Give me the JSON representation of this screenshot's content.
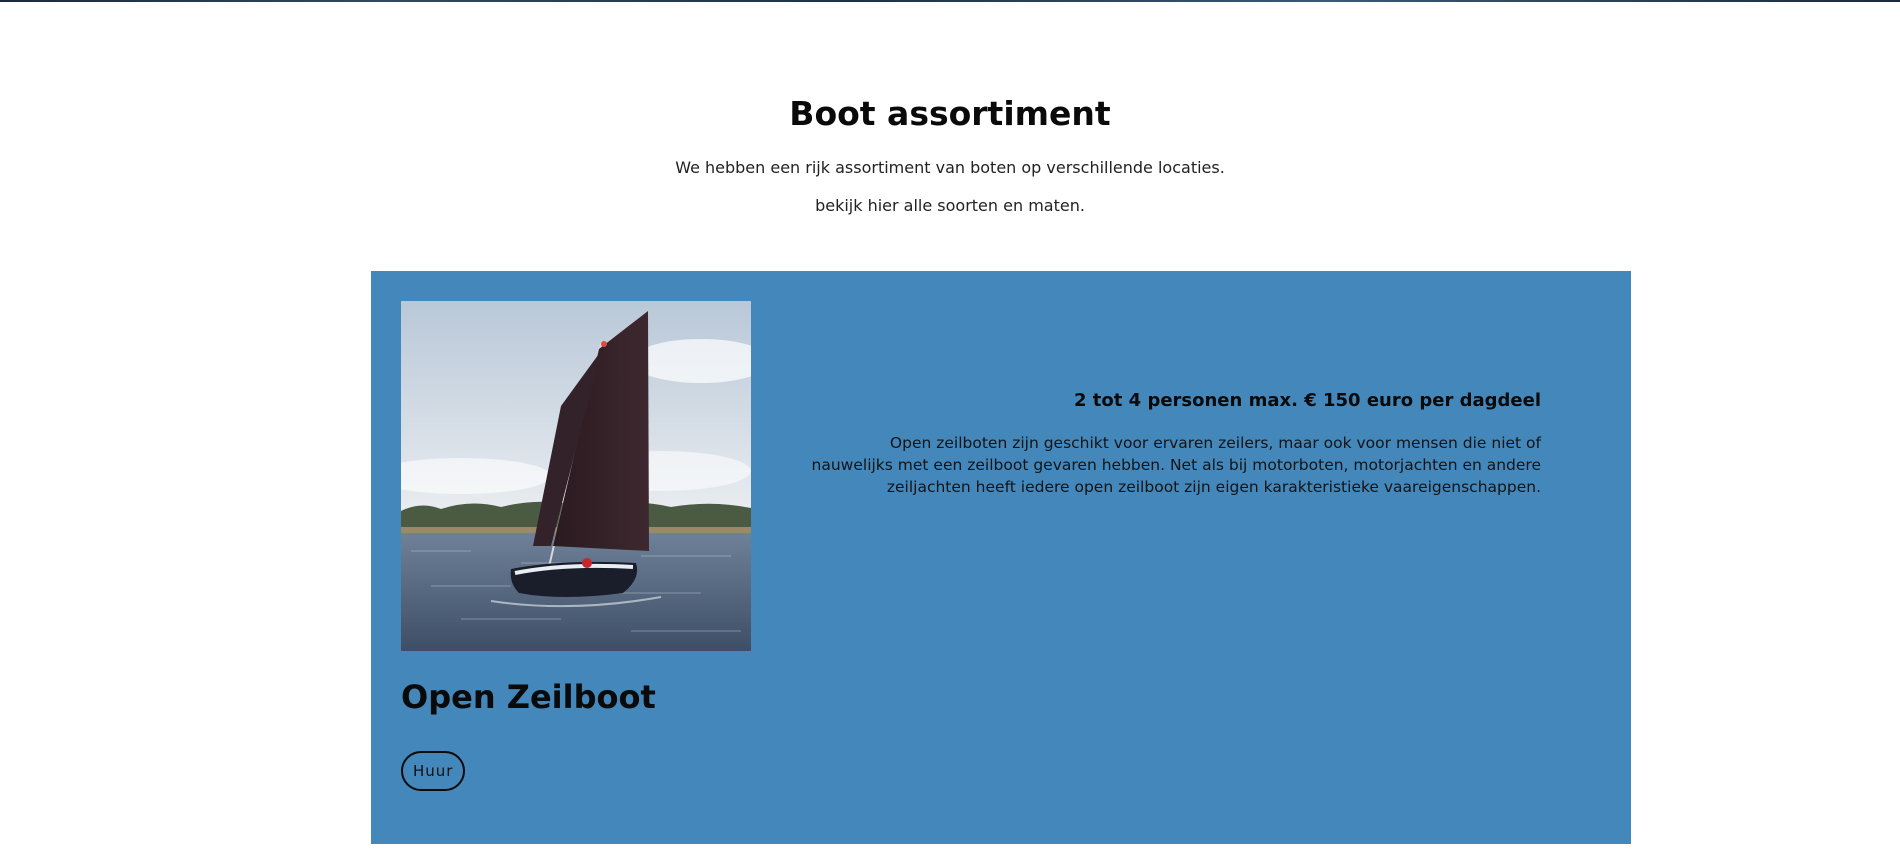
{
  "section": {
    "title": "Boot assortiment",
    "intro_line_1": "We hebben een rijk assortiment van boten op verschillende locaties.",
    "intro_line_2": "bekijk hier alle soorten en maten."
  },
  "boat_card": {
    "name": "Open Zeilboot",
    "price_line": "2 tot 4 personen max. € 150 euro per dagdeel",
    "description": "Open zeilboten zijn geschikt voor ervaren zeilers, maar ook voor mensen die niet of nauwelijks met een zeilboot gevaren hebben. Net als bij motorboten, motorjachten en andere zeiljachten heeft iedere open zeilboot zijn eigen karakteristieke vaareigenschappen.",
    "button_label": "Huur",
    "image_icon": "sailboat-photo",
    "background_color": "#4387bb"
  }
}
